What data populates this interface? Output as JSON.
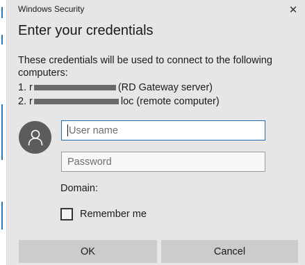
{
  "window": {
    "title": "Windows Security",
    "close_glyph": "✕"
  },
  "heading": "Enter your credentials",
  "description": {
    "line1": "These credentials will be used to connect to the following",
    "line2": "computers:"
  },
  "computers": [
    {
      "number": "1.",
      "prefix": "r",
      "suffix": "(RD Gateway server)"
    },
    {
      "number": "2.",
      "prefix": "r",
      "suffix": "loc (remote computer)"
    }
  ],
  "username": {
    "placeholder": "User name",
    "value": ""
  },
  "password": {
    "placeholder": "Password",
    "value": ""
  },
  "domain_label": "Domain:",
  "remember_me": {
    "label": "Remember me",
    "checked": false
  },
  "buttons": {
    "ok": "OK",
    "cancel": "Cancel"
  },
  "icons": {
    "avatar": "user-icon",
    "close": "close-icon"
  },
  "colors": {
    "focus_border": "#1f6fb5",
    "button_bg": "#cccccc",
    "avatar_bg": "#5c5c5c"
  }
}
